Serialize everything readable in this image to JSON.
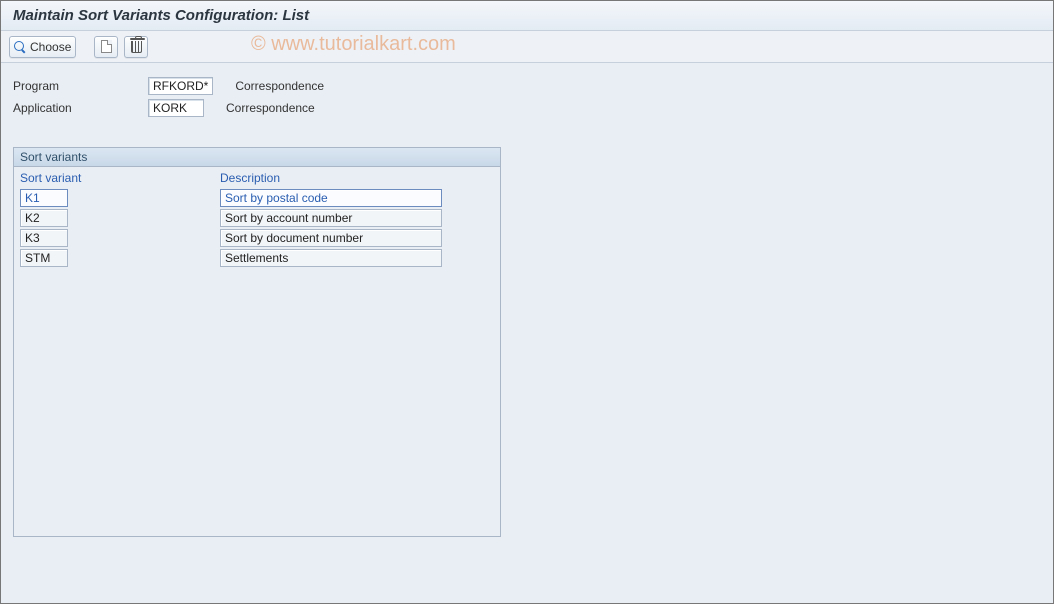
{
  "title": "Maintain Sort Variants Configuration: List",
  "watermark": "© www.tutorialkart.com",
  "toolbar": {
    "choose_label": "Choose"
  },
  "form": {
    "program_label": "Program",
    "program_value": "RFKORD*",
    "program_desc": "Correspondence",
    "application_label": "Application",
    "application_value": "KORK",
    "application_desc": "Correspondence"
  },
  "panel": {
    "title": "Sort variants",
    "col1": "Sort variant",
    "col2": "Description",
    "rows": [
      {
        "variant": "K1",
        "desc": "Sort by postal code"
      },
      {
        "variant": "K2",
        "desc": "Sort by account number"
      },
      {
        "variant": "K3",
        "desc": "Sort by document number"
      },
      {
        "variant": "STM",
        "desc": "Settlements"
      }
    ]
  }
}
